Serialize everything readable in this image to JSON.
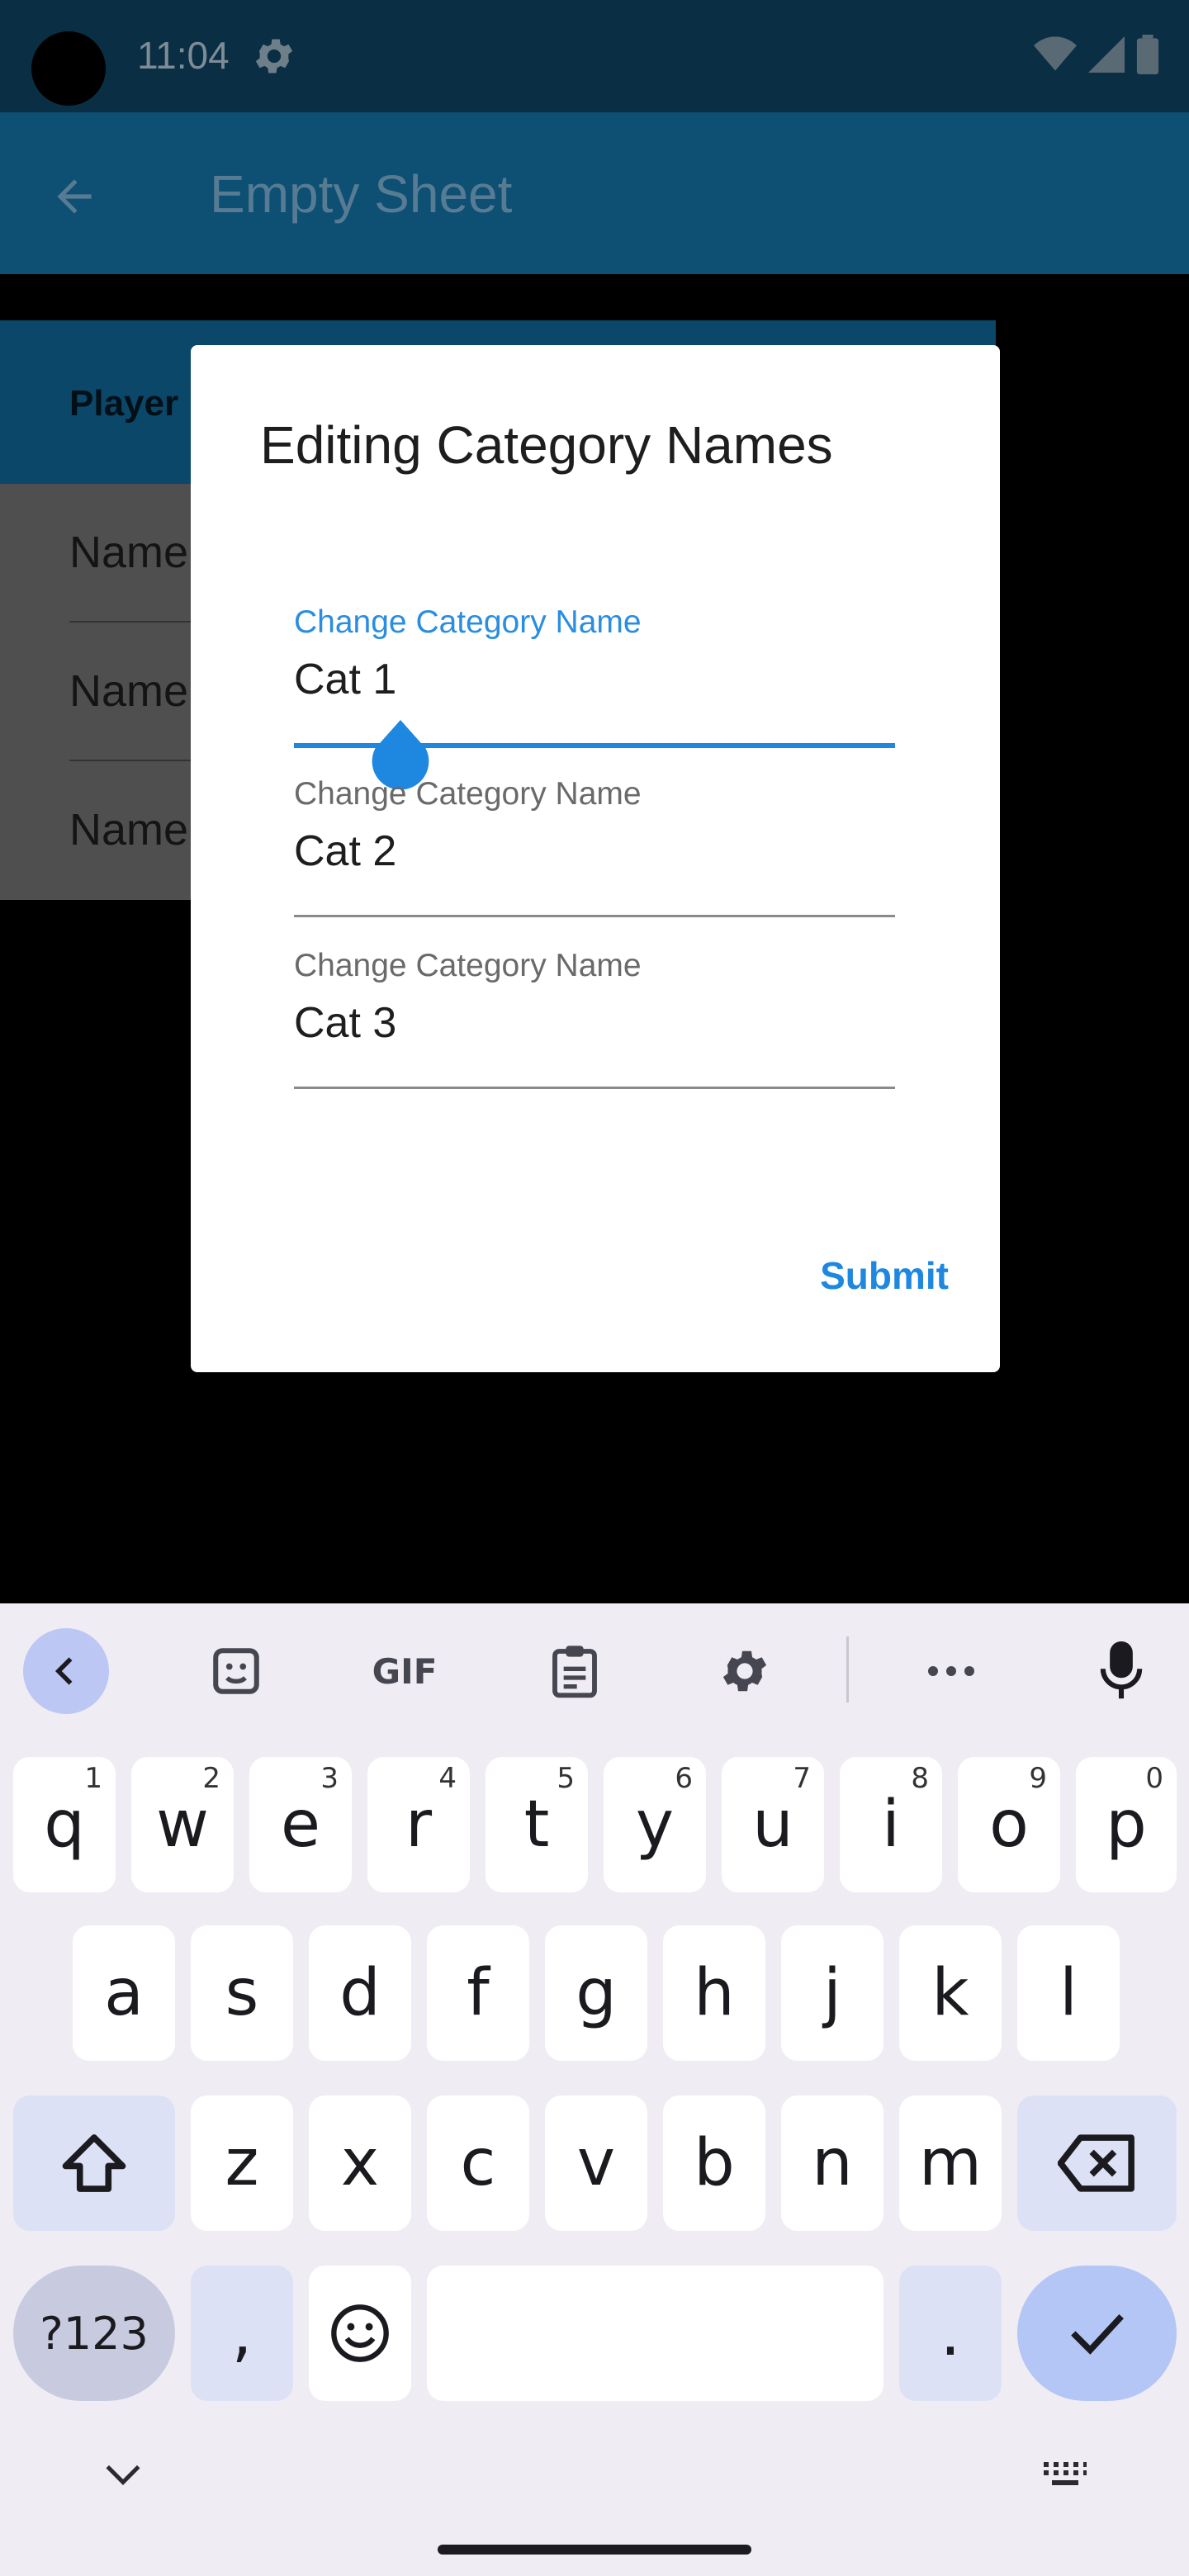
{
  "status": {
    "time": "11:04",
    "icons": [
      "settings-icon",
      "wifi-icon",
      "signal-icon",
      "battery-icon"
    ]
  },
  "app_bar": {
    "title": "Empty Sheet",
    "back_icon": "arrow-left-icon"
  },
  "background_table": {
    "header_label": "Player",
    "rows": [
      "Name",
      "Name",
      "Name"
    ]
  },
  "dialog": {
    "title": "Editing Category Names",
    "fields": [
      {
        "label": "Change Category Name",
        "value": "Cat 1",
        "focused": true
      },
      {
        "label": "Change Category Name",
        "value": "Cat 2",
        "focused": false
      },
      {
        "label": "Change Category Name",
        "value": "Cat 3",
        "focused": false
      }
    ],
    "submit_label": "Submit"
  },
  "keyboard": {
    "toolbar": [
      "back-icon",
      "sticker-icon",
      "gif-icon",
      "clipboard-icon",
      "settings-icon",
      "more-icon",
      "microphone-icon"
    ],
    "gif_label": "GIF",
    "row1": [
      {
        "key": "q",
        "hint": "1"
      },
      {
        "key": "w",
        "hint": "2"
      },
      {
        "key": "e",
        "hint": "3"
      },
      {
        "key": "r",
        "hint": "4"
      },
      {
        "key": "t",
        "hint": "5"
      },
      {
        "key": "y",
        "hint": "6"
      },
      {
        "key": "u",
        "hint": "7"
      },
      {
        "key": "i",
        "hint": "8"
      },
      {
        "key": "o",
        "hint": "9"
      },
      {
        "key": "p",
        "hint": "0"
      }
    ],
    "row2": [
      "a",
      "s",
      "d",
      "f",
      "g",
      "h",
      "j",
      "k",
      "l"
    ],
    "row3": [
      "z",
      "x",
      "c",
      "v",
      "b",
      "n",
      "m"
    ],
    "symbols_label": "?123",
    "comma_label": ",",
    "period_label": ".",
    "colors": {
      "accent": "#1e87e0",
      "keyboard_bg": "#efedf3",
      "app_bar": "#0e4f74"
    }
  }
}
